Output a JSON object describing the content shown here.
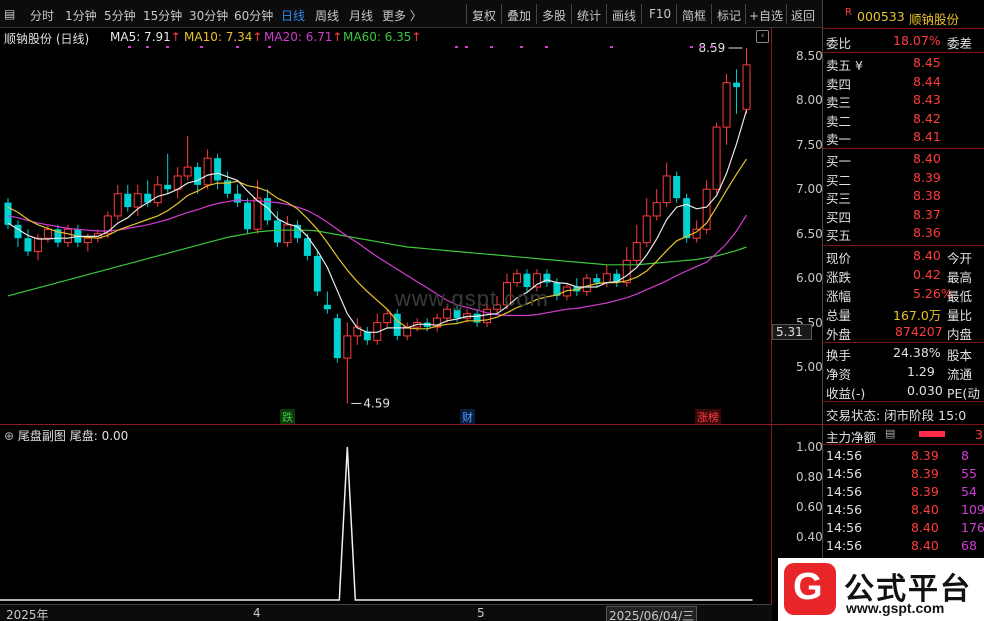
{
  "toolbar": {
    "items": [
      "分时",
      "1分钟",
      "5分钟",
      "15分钟",
      "30分钟",
      "60分钟",
      "日线",
      "周线",
      "月线",
      "更多 〉",
      "复权",
      "叠加",
      "多股",
      "统计",
      "画线",
      "F10",
      "简框",
      "标记",
      "+自选",
      "返回"
    ],
    "active_index": 6
  },
  "stock": {
    "badge": "R",
    "code": "000533",
    "name": "顺钠股份"
  },
  "main_chart": {
    "title": "顺钠股份 (日线)",
    "ma": [
      {
        "label": "MA5: 7.91",
        "color": "#e8e8e8"
      },
      {
        "label": "MA10: 7.34",
        "color": "#e6c229"
      },
      {
        "label": "MA20: 6.71",
        "color": "#d23cd2"
      },
      {
        "label": "MA60: 6.35",
        "color": "#3cc83c"
      }
    ],
    "arrow": "↑",
    "y_axis": [
      "8.50",
      "8.00",
      "7.50",
      "7.00",
      "6.50",
      "6.00",
      "5.50",
      "5.00"
    ],
    "current_price_tag": "5.31",
    "high_label": "8.59",
    "low_label": "4.59",
    "event_tags": [
      {
        "text": "跌",
        "color": "#3cc83c"
      },
      {
        "text": "财",
        "color": "#4fa3ff"
      },
      {
        "text": "涨榜",
        "color": "#ff3c3c"
      }
    ],
    "watermark": "www.gspt.com"
  },
  "chart_data": {
    "type": "candlestick",
    "ylim": [
      4.5,
      8.7
    ],
    "candles": [
      [
        6.85,
        6.6,
        6.9,
        6.55
      ],
      [
        6.6,
        6.45,
        6.65,
        6.35
      ],
      [
        6.45,
        6.3,
        6.55,
        6.25
      ],
      [
        6.3,
        6.45,
        6.5,
        6.2
      ],
      [
        6.45,
        6.55,
        6.6,
        6.4
      ],
      [
        6.55,
        6.4,
        6.6,
        6.35
      ],
      [
        6.4,
        6.55,
        6.6,
        6.35
      ],
      [
        6.55,
        6.4,
        6.6,
        6.35
      ],
      [
        6.4,
        6.45,
        6.5,
        6.3
      ],
      [
        6.45,
        6.5,
        6.55,
        6.4
      ],
      [
        6.5,
        6.7,
        6.75,
        6.45
      ],
      [
        6.7,
        6.95,
        7.05,
        6.65
      ],
      [
        6.95,
        6.8,
        7.05,
        6.75
      ],
      [
        6.8,
        6.95,
        7.05,
        6.7
      ],
      [
        6.95,
        6.85,
        7.1,
        6.8
      ],
      [
        6.85,
        7.05,
        7.15,
        6.8
      ],
      [
        7.05,
        7.0,
        7.4,
        6.95
      ],
      [
        7.0,
        7.15,
        7.25,
        6.9
      ],
      [
        7.15,
        7.25,
        7.6,
        7.1
      ],
      [
        7.25,
        7.05,
        7.3,
        6.95
      ],
      [
        7.05,
        7.35,
        7.45,
        7.0
      ],
      [
        7.35,
        7.1,
        7.4,
        7.0
      ],
      [
        7.1,
        6.95,
        7.2,
        6.9
      ],
      [
        6.95,
        6.85,
        7.05,
        6.8
      ],
      [
        6.85,
        6.55,
        6.9,
        6.5
      ],
      [
        6.55,
        6.9,
        7.1,
        6.5
      ],
      [
        6.9,
        6.65,
        7.0,
        6.6
      ],
      [
        6.65,
        6.4,
        6.75,
        6.35
      ],
      [
        6.4,
        6.6,
        6.7,
        6.35
      ],
      [
        6.6,
        6.45,
        6.65,
        6.4
      ],
      [
        6.45,
        6.25,
        6.5,
        6.2
      ],
      [
        6.25,
        5.85,
        6.3,
        5.8
      ],
      [
        5.7,
        5.65,
        5.85,
        5.6
      ],
      [
        5.55,
        5.1,
        5.6,
        5.05
      ],
      [
        5.1,
        5.35,
        5.5,
        4.59
      ],
      [
        5.35,
        5.45,
        5.55,
        5.25
      ],
      [
        5.4,
        5.3,
        5.45,
        5.25
      ],
      [
        5.3,
        5.5,
        5.6,
        5.25
      ],
      [
        5.5,
        5.6,
        5.65,
        5.45
      ],
      [
        5.6,
        5.35,
        5.65,
        5.3
      ],
      [
        5.35,
        5.45,
        5.5,
        5.3
      ],
      [
        5.45,
        5.5,
        5.55,
        5.4
      ],
      [
        5.5,
        5.45,
        5.55,
        5.4
      ],
      [
        5.45,
        5.55,
        5.6,
        5.4
      ],
      [
        5.55,
        5.65,
        5.7,
        5.5
      ],
      [
        5.65,
        5.55,
        5.7,
        5.5
      ],
      [
        5.55,
        5.6,
        5.65,
        5.5
      ],
      [
        5.6,
        5.5,
        5.65,
        5.45
      ],
      [
        5.5,
        5.65,
        5.75,
        5.45
      ],
      [
        5.65,
        5.7,
        5.8,
        5.6
      ],
      [
        5.7,
        5.95,
        6.05,
        5.65
      ],
      [
        5.95,
        6.05,
        6.1,
        5.9
      ],
      [
        6.05,
        5.9,
        6.1,
        5.85
      ],
      [
        5.9,
        6.05,
        6.1,
        5.85
      ],
      [
        6.05,
        5.95,
        6.1,
        5.9
      ],
      [
        5.95,
        5.8,
        6.0,
        5.75
      ],
      [
        5.8,
        5.9,
        5.95,
        5.75
      ],
      [
        5.9,
        5.85,
        6.0,
        5.8
      ],
      [
        5.85,
        6.0,
        6.05,
        5.8
      ],
      [
        6.0,
        5.95,
        6.05,
        5.9
      ],
      [
        5.95,
        6.05,
        6.15,
        5.9
      ],
      [
        6.05,
        5.95,
        6.1,
        5.9
      ],
      [
        5.95,
        6.2,
        6.35,
        5.9
      ],
      [
        6.2,
        6.4,
        6.6,
        6.15
      ],
      [
        6.4,
        6.7,
        6.9,
        6.35
      ],
      [
        6.7,
        6.85,
        7.0,
        6.65
      ],
      [
        6.85,
        7.15,
        7.3,
        6.8
      ],
      [
        7.15,
        6.9,
        7.2,
        6.85
      ],
      [
        6.9,
        6.45,
        6.95,
        6.4
      ],
      [
        6.45,
        6.55,
        6.65,
        6.4
      ],
      [
        6.55,
        7.0,
        7.1,
        6.5
      ],
      [
        7.0,
        7.7,
        7.75,
        6.95
      ],
      [
        7.7,
        8.2,
        8.3,
        7.5
      ],
      [
        8.2,
        8.15,
        8.35,
        7.85
      ],
      [
        7.9,
        8.4,
        8.59,
        7.85
      ]
    ],
    "ma5": [
      6.62,
      6.55,
      6.48,
      6.44,
      6.44,
      6.45,
      6.45,
      6.47,
      6.47,
      6.47,
      6.52,
      6.62,
      6.68,
      6.78,
      6.85,
      6.92,
      6.95,
      7.0,
      7.07,
      7.1,
      7.16,
      7.18,
      7.14,
      7.1,
      6.98,
      6.87,
      6.79,
      6.67,
      6.61,
      6.58,
      6.47,
      6.31,
      6.12,
      5.86,
      5.6,
      5.44,
      5.39,
      5.39,
      5.44,
      5.44,
      5.44,
      5.48,
      5.48,
      5.47,
      5.52,
      5.54,
      5.57,
      5.57,
      5.59,
      5.6,
      5.68,
      5.78,
      5.84,
      5.93,
      5.98,
      5.95,
      5.94,
      5.9,
      5.9,
      5.9,
      5.95,
      5.96,
      6.03,
      6.12,
      6.26,
      6.44,
      6.66,
      6.8,
      6.83,
      6.78,
      6.8,
      6.93,
      7.18,
      7.51,
      7.89
    ],
    "ma10": [
      6.8,
      6.74,
      6.66,
      6.6,
      6.56,
      6.52,
      6.5,
      6.47,
      6.46,
      6.45,
      6.48,
      6.54,
      6.58,
      6.62,
      6.66,
      6.7,
      6.76,
      6.84,
      6.93,
      6.98,
      7.04,
      7.07,
      7.07,
      7.09,
      7.04,
      7.02,
      6.98,
      6.9,
      6.85,
      6.78,
      6.67,
      6.55,
      6.4,
      6.24,
      6.09,
      5.96,
      5.85,
      5.75,
      5.65,
      5.52,
      5.44,
      5.43,
      5.43,
      5.46,
      5.48,
      5.49,
      5.52,
      5.52,
      5.53,
      5.56,
      5.61,
      5.67,
      5.71,
      5.76,
      5.79,
      5.81,
      5.86,
      5.87,
      5.91,
      5.94,
      5.95,
      5.95,
      5.97,
      6.01,
      6.08,
      6.19,
      6.31,
      6.42,
      6.47,
      6.52,
      6.62,
      6.8,
      6.99,
      7.17,
      7.34
    ],
    "ma20": [
      6.7,
      6.68,
      6.65,
      6.62,
      6.6,
      6.58,
      6.56,
      6.55,
      6.54,
      6.53,
      6.53,
      6.54,
      6.56,
      6.58,
      6.6,
      6.63,
      6.66,
      6.7,
      6.74,
      6.77,
      6.81,
      6.84,
      6.86,
      6.88,
      6.87,
      6.87,
      6.86,
      6.85,
      6.83,
      6.8,
      6.76,
      6.7,
      6.63,
      6.55,
      6.47,
      6.4,
      6.32,
      6.24,
      6.17,
      6.1,
      6.03,
      5.96,
      5.89,
      5.82,
      5.75,
      5.7,
      5.67,
      5.64,
      5.61,
      5.59,
      5.58,
      5.58,
      5.58,
      5.59,
      5.61,
      5.63,
      5.65,
      5.66,
      5.68,
      5.7,
      5.72,
      5.75,
      5.78,
      5.82,
      5.87,
      5.92,
      5.97,
      6.03,
      6.08,
      6.13,
      6.18,
      6.28,
      6.39,
      6.53,
      6.71
    ],
    "ma60": [
      5.8,
      5.83,
      5.86,
      5.89,
      5.92,
      5.95,
      5.98,
      6.01,
      6.04,
      6.07,
      6.1,
      6.13,
      6.16,
      6.19,
      6.22,
      6.25,
      6.28,
      6.31,
      6.34,
      6.37,
      6.4,
      6.43,
      6.46,
      6.48,
      6.5,
      6.52,
      6.53,
      6.54,
      6.54,
      6.54,
      6.54,
      6.53,
      6.51,
      6.49,
      6.47,
      6.45,
      6.43,
      6.41,
      6.39,
      6.37,
      6.35,
      6.34,
      6.33,
      6.32,
      6.31,
      6.3,
      6.29,
      6.28,
      6.27,
      6.26,
      6.25,
      6.24,
      6.23,
      6.22,
      6.21,
      6.2,
      6.19,
      6.18,
      6.17,
      6.16,
      6.15,
      6.15,
      6.15,
      6.15,
      6.16,
      6.17,
      6.18,
      6.19,
      6.2,
      6.21,
      6.23,
      6.25,
      6.28,
      6.31,
      6.35
    ]
  },
  "sub_chart": {
    "title": "尾盘副图",
    "value_label": "尾盘: 0.00",
    "y_axis": [
      "1.00",
      "0.80",
      "0.60",
      "0.40"
    ],
    "spike_index": 34,
    "spike_value": 1.0
  },
  "date_axis": [
    "2025年",
    "4",
    "5",
    "2025/06/04/三"
  ],
  "panel": {
    "weibi": {
      "label": "委比",
      "value": "18.07%",
      "right": "委差"
    },
    "asks": [
      {
        "label": "卖五 ¥",
        "price": "8.45"
      },
      {
        "label": "卖四",
        "price": "8.44"
      },
      {
        "label": "卖三",
        "price": "8.43"
      },
      {
        "label": "卖二",
        "price": "8.42"
      },
      {
        "label": "卖一",
        "price": "8.41"
      }
    ],
    "bids": [
      {
        "label": "买一",
        "price": "8.40"
      },
      {
        "label": "买二",
        "price": "8.39"
      },
      {
        "label": "买三",
        "price": "8.38"
      },
      {
        "label": "买四",
        "price": "8.37"
      },
      {
        "label": "买五",
        "price": "8.36"
      }
    ],
    "stats": [
      {
        "label": "现价",
        "value": "8.40",
        "right": "今开",
        "color": "red"
      },
      {
        "label": "涨跌",
        "value": "0.42",
        "right": "最高",
        "color": "red"
      },
      {
        "label": "涨幅",
        "value": "5.26%",
        "right": "最低",
        "color": "red"
      },
      {
        "label": "总量",
        "value": "167.0万",
        "right": "量比",
        "color": "yel"
      },
      {
        "label": "外盘",
        "value": "874207",
        "right": "内盘",
        "color": "red"
      }
    ],
    "fin": [
      {
        "label": "换手",
        "value": "24.38%",
        "right": "股本"
      },
      {
        "label": "净资",
        "value": "1.29",
        "right": "流通"
      },
      {
        "label": "收益(-)",
        "value": "0.030",
        "right": "PE(动"
      }
    ],
    "trade_state": "交易状态: 闭市阶段 15:0",
    "capital_label": "主力净额",
    "capital_value": "3",
    "ticks": [
      {
        "time": "14:56",
        "price": "8.39",
        "vol": "8"
      },
      {
        "time": "14:56",
        "price": "8.39",
        "vol": "55"
      },
      {
        "time": "14:56",
        "price": "8.39",
        "vol": "54"
      },
      {
        "time": "14:56",
        "price": "8.40",
        "vol": "109"
      },
      {
        "time": "14:56",
        "price": "8.40",
        "vol": "176"
      },
      {
        "time": "14:56",
        "price": "8.40",
        "vol": "68"
      }
    ]
  },
  "brand": {
    "logo_letter": "G",
    "name": "公式平台",
    "url": "www.gspt.com"
  }
}
